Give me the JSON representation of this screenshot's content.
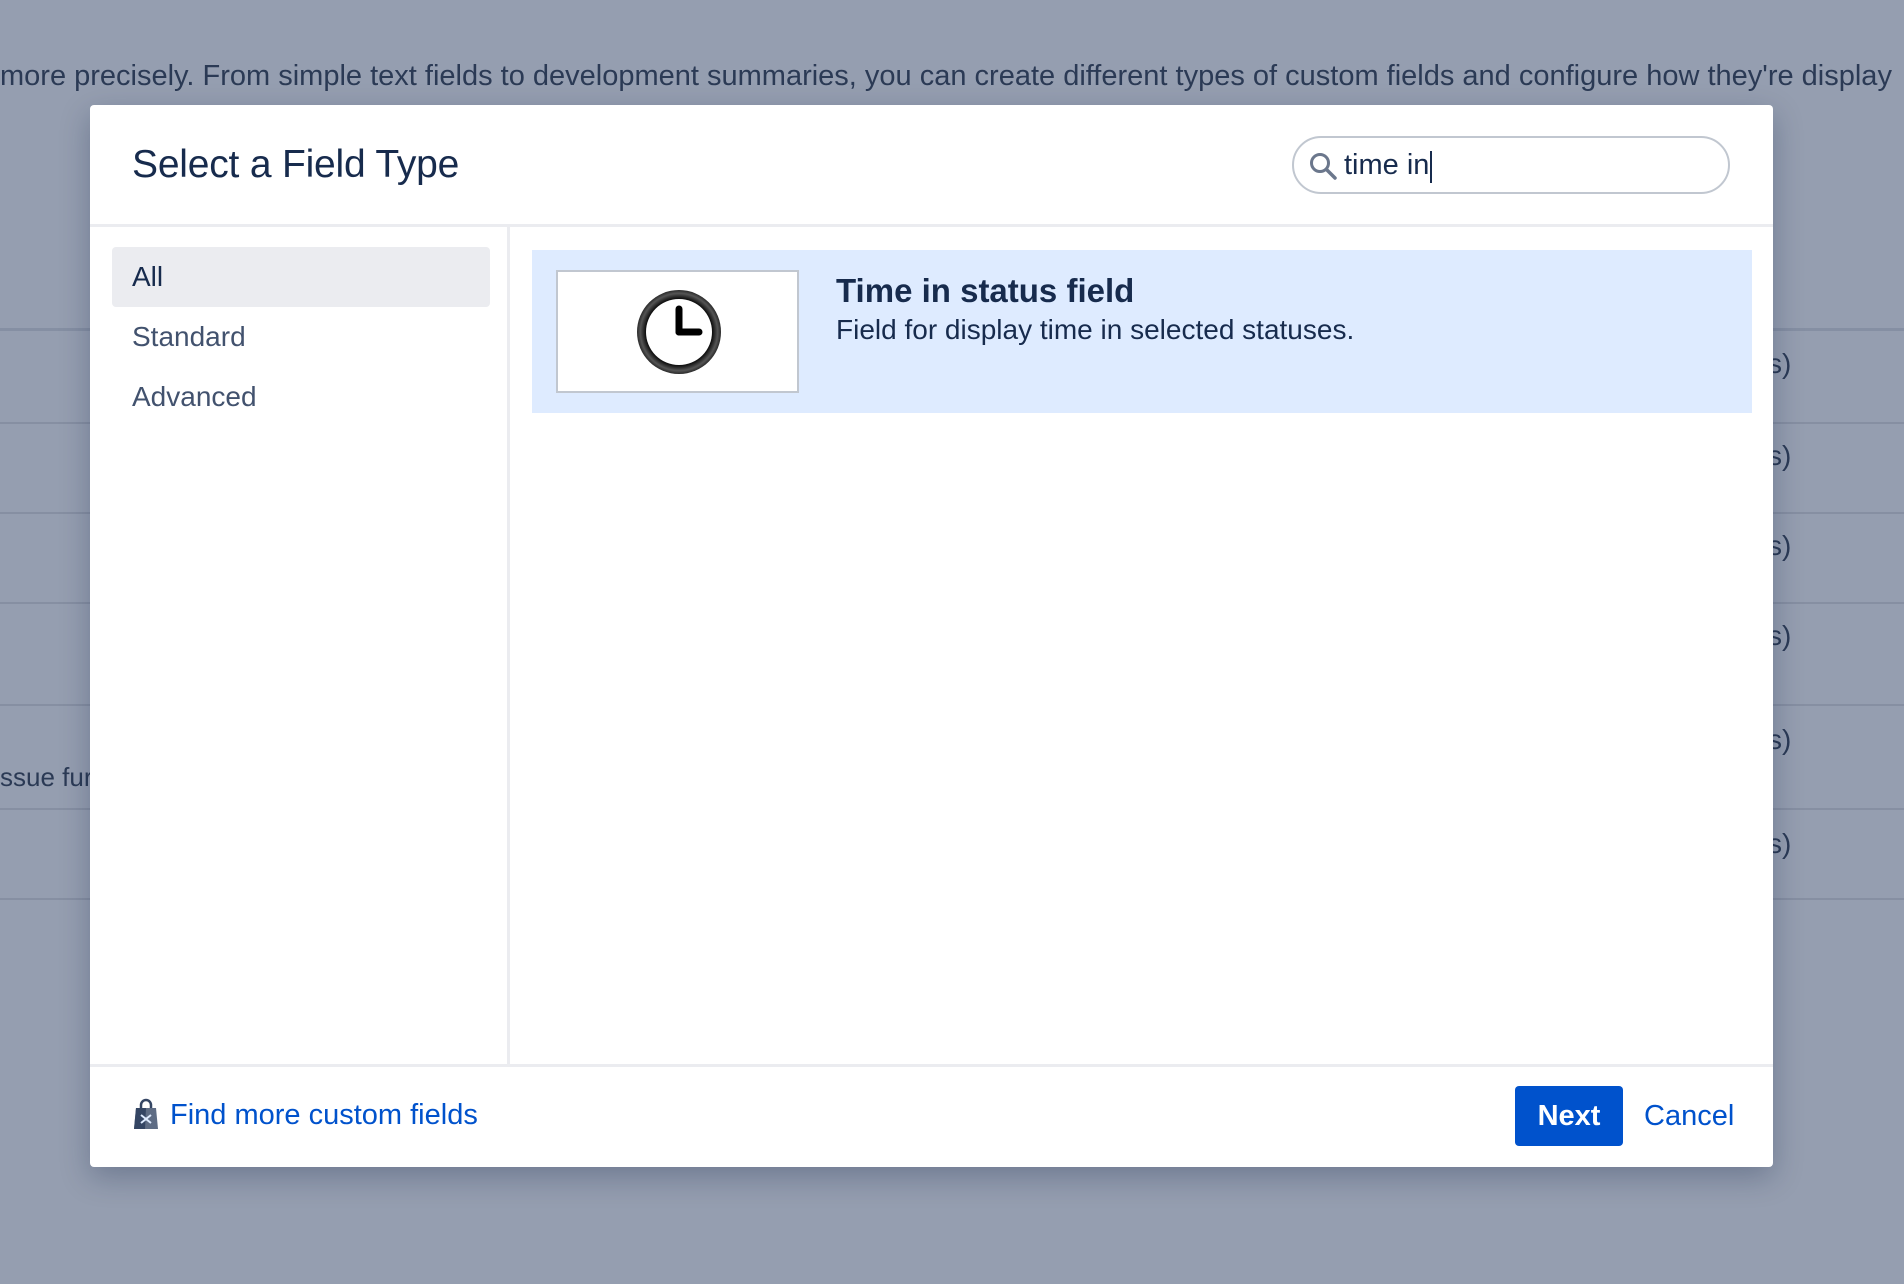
{
  "background": {
    "intro_text": "more precisely. From simple text fields to development summaries, you can create different types of custom fields and configure how they're display",
    "row_suffix": "s)",
    "left_fragment": "ssue fur"
  },
  "modal": {
    "title": "Select a Field Type",
    "search": {
      "value": "time in",
      "icon": "search-icon"
    },
    "categories": [
      {
        "label": "All",
        "selected": true
      },
      {
        "label": "Standard",
        "selected": false
      },
      {
        "label": "Advanced",
        "selected": false
      }
    ],
    "results": [
      {
        "title": "Time in status field",
        "description": "Field for display time in selected statuses.",
        "icon": "clock-icon",
        "selected": true
      }
    ],
    "footer": {
      "find_more_label": "Find more custom fields",
      "find_more_icon": "shopping-bag-icon",
      "next_label": "Next",
      "cancel_label": "Cancel"
    }
  },
  "colors": {
    "overlay": "#959eb0",
    "primary": "#0052cc",
    "selected_result": "#deebff",
    "selected_category": "#ebecf0",
    "text": "#172b4d"
  }
}
